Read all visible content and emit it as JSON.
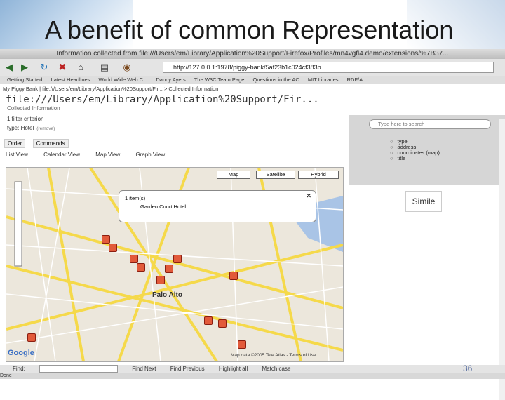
{
  "slide": {
    "title": "A benefit of common Representation",
    "number": "36"
  },
  "browser": {
    "window_title": "Information collected from file:///Users/em/Library/Application%20Support/Firefox/Profiles/mn4vgfl4.demo/extensions/%7B37...",
    "url": "http://127.0.0.1:1978/piggy-bank/5af23b1c024cf383b",
    "bookmarks": [
      "Getting Started",
      "Latest Headlines",
      "World Wide Web C...",
      "Danny Ayers",
      "The W3C Team Page",
      "Questions in the AC",
      "MIT Libraries",
      "RDF/A"
    ],
    "status": "Done"
  },
  "page": {
    "breadcrumb": "My Piggy Bank | file:///Users/em/Library/Application%20Support/Fir... > Collected Information",
    "title": "file:///Users/em/Library/Application%20Support/Fir...",
    "subtitle": "Collected Information",
    "filter_count": "1 filter criterion",
    "filter_item": "type: Hotel",
    "filter_remove": "(remove)",
    "tabs": [
      "Order",
      "Commands"
    ],
    "views": [
      "List View",
      "Calendar View",
      "Map View",
      "Graph View"
    ],
    "search_placeholder": "Type here to search",
    "facets": [
      "type",
      "address",
      "coordinates (map)",
      "title"
    ],
    "simile": "Simile"
  },
  "map": {
    "buttons": [
      "Map",
      "Satellite",
      "Hybrid"
    ],
    "popup_count": "1 item(s)",
    "popup_item": "Garden Court Hotel",
    "city_label": "Palo Alto",
    "copyright": "Map data ©2005 Tele Atlas - Terms of Use",
    "logo": "Google"
  },
  "findbar": {
    "find_label": "Find:",
    "next": "Find Next",
    "previous": "Find Previous",
    "highlight": "Highlight all",
    "match": "Match case"
  }
}
